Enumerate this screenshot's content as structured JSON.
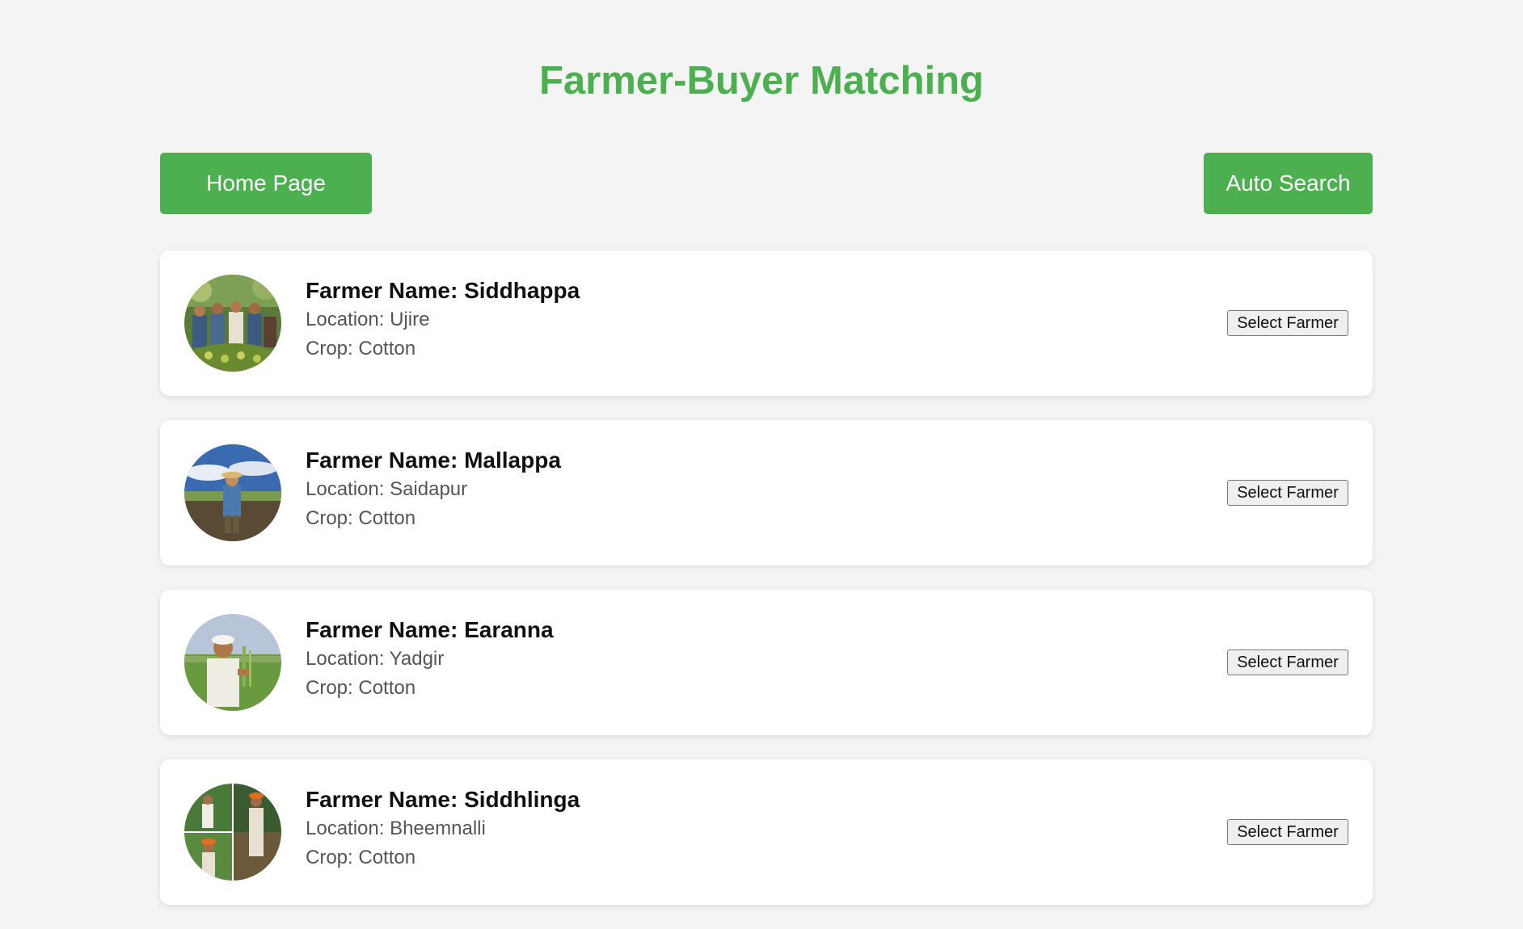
{
  "page": {
    "title": "Farmer-Buyer Matching"
  },
  "nav": {
    "home_label": "Home Page",
    "auto_search_label": "Auto Search"
  },
  "colors": {
    "accent": "#4caf50",
    "background": "#f4f4f4"
  },
  "farmers": [
    {
      "name": "Farmer Name: Siddhappa",
      "location": "Location: Ujire",
      "crop": "Crop: Cotton",
      "button": "Select Farmer",
      "photo_icon": "farmers-with-baskets-photo"
    },
    {
      "name": "Farmer Name: Mallappa",
      "location": "Location: Saidapur",
      "crop": "Crop: Cotton",
      "button": "Select Farmer",
      "photo_icon": "farmer-in-field-sky-photo"
    },
    {
      "name": "Farmer Name: Earanna",
      "location": "Location: Yadgir",
      "crop": "Crop: Cotton",
      "button": "Select Farmer",
      "photo_icon": "farmer-with-crop-photo"
    },
    {
      "name": "Farmer Name: Siddhlinga",
      "location": "Location: Bheemnalli",
      "crop": "Crop: Cotton",
      "button": "Select Farmer",
      "photo_icon": "farmers-collage-photo"
    }
  ]
}
